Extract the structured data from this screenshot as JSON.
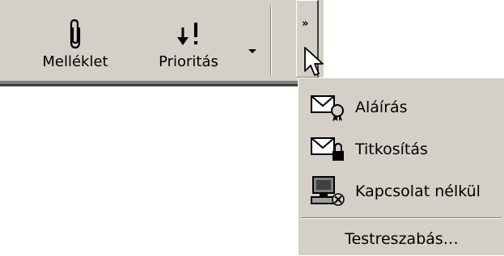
{
  "toolbar": {
    "attach_label": "Melléklet",
    "attach_icon": "paperclip-icon",
    "priority_label": "Prioritás",
    "priority_icon": "priority-icon",
    "dropdown_icon": "dropdown-arrow-icon",
    "chevron_text": "»",
    "chevron_icon": "chevron-more-icon"
  },
  "menu": {
    "items": [
      {
        "label": "Aláírás",
        "icon": "signature-envelope-icon"
      },
      {
        "label": "Titkosítás",
        "icon": "encrypted-envelope-icon"
      },
      {
        "label": "Kapcsolat nélkül",
        "icon": "offline-computer-icon"
      }
    ],
    "customize_label": "Testreszabás…"
  },
  "colors": {
    "face": "#d4d0c8",
    "shadow": "#808080",
    "dark_shadow": "#404040",
    "highlight": "#ffffff"
  }
}
